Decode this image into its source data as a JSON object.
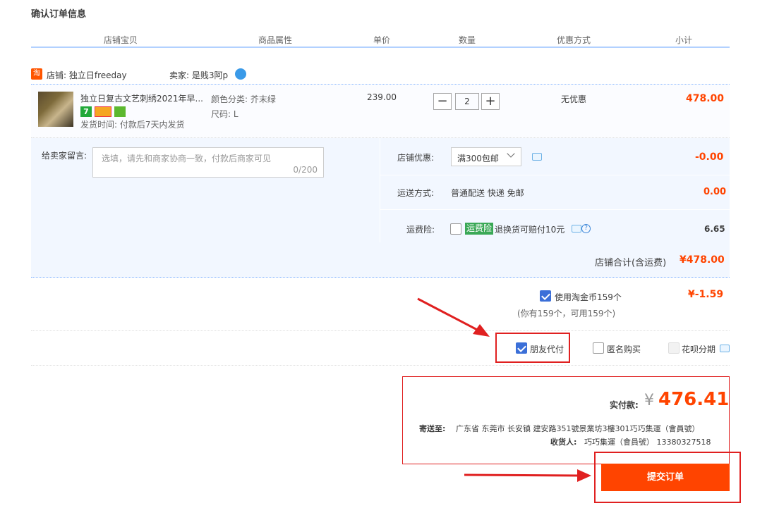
{
  "page_title": "确认订单信息",
  "table_headers": [
    "店铺宝贝",
    "商品属性",
    "单价",
    "数量",
    "优惠方式",
    "小计"
  ],
  "shop": {
    "logo_text": "淘",
    "shop_label": "店铺: 独立日freeday",
    "seller_label": "卖家: 是贱3阿p"
  },
  "item": {
    "name": "独立日复古文艺刺绣2021年早...",
    "badge_seven": "7",
    "ship_time": "发货时间: 付款后7天内发货",
    "attr_color": "颜色分类: 芥末绿",
    "attr_size": "尺码: L",
    "unit_price": "239.00",
    "quantity": "2",
    "minus": "−",
    "plus": "+",
    "discount": "无优惠",
    "subtotal": "478.00"
  },
  "message": {
    "label": "给卖家留言:",
    "placeholder": "选填，请先和商家协商一致，付款后商家可见",
    "counter": "0/200"
  },
  "shop_discount": {
    "label": "店铺优惠:",
    "selected": "满300包邮",
    "amount": "-0.00"
  },
  "shipping": {
    "label": "运送方式:",
    "value": "普通配送 快递 免邮",
    "amount": "0.00"
  },
  "insurance": {
    "label": "运费险:",
    "tag": "运费险",
    "desc": "退换货可赔付10元",
    "amount": "6.65",
    "help": "?"
  },
  "shop_total": {
    "label": "店铺合计(含运费)",
    "amount": "¥478.00"
  },
  "coins": {
    "label": "使用淘金币159个",
    "sub": "(你有159个，可用159个)",
    "amount": "¥-1.59"
  },
  "options": {
    "friend_pay": "朋友代付",
    "anonymous": "匿名购买",
    "huabei": "花呗分期"
  },
  "payment": {
    "label": "实付款:",
    "currency": "¥",
    "amount": "476.41",
    "ship_to_label": "寄送至:",
    "address": "广东省 东莞市 长安镇 建安路351號景業坊3樓301巧巧集運（會員號）",
    "receiver_label": "收货人:",
    "receiver": "巧巧集運（會員號） 13380327518"
  },
  "submit_label": "提交订单",
  "colors": {
    "accent": "#ff4400",
    "highlight": "#e02020",
    "header_line": "#b2d1ff",
    "panel": "#f2f7ff"
  }
}
